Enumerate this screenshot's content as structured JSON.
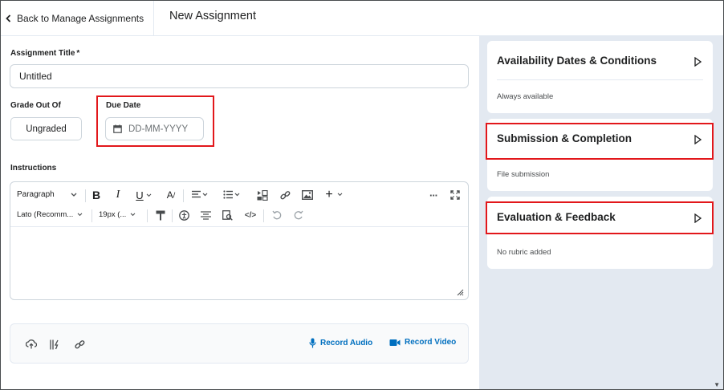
{
  "header": {
    "back_label": "Back to Manage Assignments",
    "page_title": "New Assignment"
  },
  "form": {
    "title_label": "Assignment Title",
    "required_marker": "*",
    "title_value": "Untitled",
    "grade_label": "Grade Out Of",
    "grade_value": "Ungraded",
    "due_label": "Due Date",
    "due_placeholder": "DD-MM-YYYY",
    "instructions_label": "Instructions"
  },
  "editor": {
    "format_select": "Paragraph",
    "font_select": "Lato (Recomm...",
    "size_select": "19px (..."
  },
  "attachments": {
    "record_audio": "Record Audio",
    "record_video": "Record Video"
  },
  "sidebar": {
    "cards": [
      {
        "title": "Availability Dates & Conditions",
        "subtitle": "Always available"
      },
      {
        "title": "Submission & Completion",
        "subtitle": "File submission"
      },
      {
        "title": "Evaluation & Feedback",
        "subtitle": "No rubric added"
      }
    ]
  },
  "colors": {
    "highlight_red": "#e2171b",
    "link_blue": "#006fbf",
    "panel_bg": "#e3e9f1"
  },
  "icons": [
    "chevron-left-icon",
    "calendar-icon",
    "bold-icon",
    "italic-icon",
    "underline-icon",
    "font-color-icon",
    "align-icon",
    "list-icon",
    "insert-stuff-icon",
    "link-icon",
    "image-icon",
    "plus-icon",
    "more-icon",
    "fullscreen-icon",
    "format-painter-icon",
    "accessibility-icon",
    "html-icon",
    "preview-icon",
    "code-icon",
    "undo-icon",
    "redo-icon",
    "upload-icon",
    "attach-icon",
    "link-icon",
    "microphone-icon",
    "video-icon",
    "triangle-right-icon"
  ]
}
